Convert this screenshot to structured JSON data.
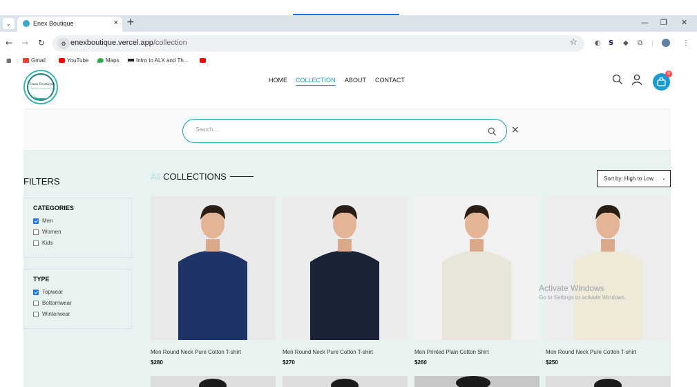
{
  "browser": {
    "tab_title": "Enex Boutique",
    "url_host": "enexboutique.vercel.app",
    "url_path": "/collection",
    "bookmarks": [
      {
        "label": "Gmail",
        "icon": "gmail-icon",
        "color": "#ea4335"
      },
      {
        "label": "YouTube",
        "icon": "youtube-icon",
        "color": "#ff0000"
      },
      {
        "label": "Maps",
        "icon": "maps-icon",
        "color": "#34a853"
      },
      {
        "label": "Intro to ALX and Th...",
        "icon": "alx-icon",
        "color": "#222222"
      }
    ]
  },
  "site": {
    "logo": {
      "name": "Enex Boutique",
      "tagline": "Fashion is everything"
    },
    "nav": [
      "HOME",
      "COLLECTION",
      "ABOUT",
      "CONTACT"
    ],
    "active_nav": "COLLECTION",
    "cart_count": "0",
    "accent": "#1a9ab5"
  },
  "search": {
    "placeholder": "Search..."
  },
  "filters": {
    "title": "FILTERS",
    "categories": {
      "title": "CATEGORIES",
      "options": [
        {
          "label": "Men",
          "checked": true
        },
        {
          "label": "Women",
          "checked": false
        },
        {
          "label": "Kids",
          "checked": false
        }
      ]
    },
    "type": {
      "title": "TYPE",
      "options": [
        {
          "label": "Topwear",
          "checked": true
        },
        {
          "label": "Bottomwear",
          "checked": false
        },
        {
          "label": "Winterwear",
          "checked": false
        }
      ]
    }
  },
  "collection": {
    "title_prefix": "All",
    "title_main": "COLLECTIONS",
    "sort_label": "Sort by: High to Low",
    "products": [
      {
        "name": "Men Round Neck Pure Cotton T-shirt",
        "price": "$280",
        "shirt_color": "#1e3466",
        "bg": "#e9e9e9"
      },
      {
        "name": "Men Round Neck Pure Cotton T-shirt",
        "price": "$270",
        "shirt_color": "#1b2436",
        "bg": "#ececec"
      },
      {
        "name": "Men Printed Plain Cotton Shirt",
        "price": "$260",
        "shirt_color": "#e9e5da",
        "bg": "#f1f1f1"
      },
      {
        "name": "Men Round Neck Pure Cotton T-shirt",
        "price": "$250",
        "shirt_color": "#efe9d8",
        "bg": "#ededed"
      }
    ]
  },
  "overlay": {
    "line1": "Activate Windows",
    "line2": "Go to Settings to activate Windows."
  }
}
